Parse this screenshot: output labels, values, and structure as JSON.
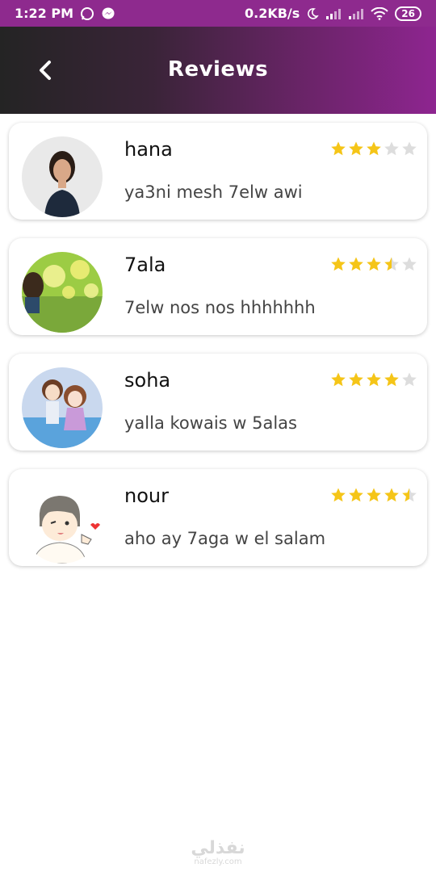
{
  "status_bar": {
    "time": "1:22 PM",
    "network_speed": "0.2KB/s",
    "battery": "26",
    "icons": [
      "whatsapp-icon",
      "messenger-icon",
      "moon-icon",
      "signal-icon",
      "signal-icon",
      "wifi-icon",
      "battery-icon"
    ]
  },
  "header": {
    "title": "Reviews",
    "back_icon": "chevron-left-icon",
    "gradient": [
      "#242424",
      "#8e2590"
    ]
  },
  "colors": {
    "star_on": "#f5c518",
    "star_off": "#dddddd"
  },
  "reviews": [
    {
      "name": "hana",
      "comment": "ya3ni mesh 7elw awi",
      "rating": 3
    },
    {
      "name": "7ala",
      "comment": "7elw nos nos hhhhhhh",
      "rating": 3.5
    },
    {
      "name": "soha",
      "comment": "yalla kowais w 5alas",
      "rating": 4
    },
    {
      "name": "nour",
      "comment": "aho ay 7aga w el salam",
      "rating": 4.5
    }
  ],
  "watermark": {
    "arabic": "نفذلي",
    "latin": "nafezly.com"
  }
}
